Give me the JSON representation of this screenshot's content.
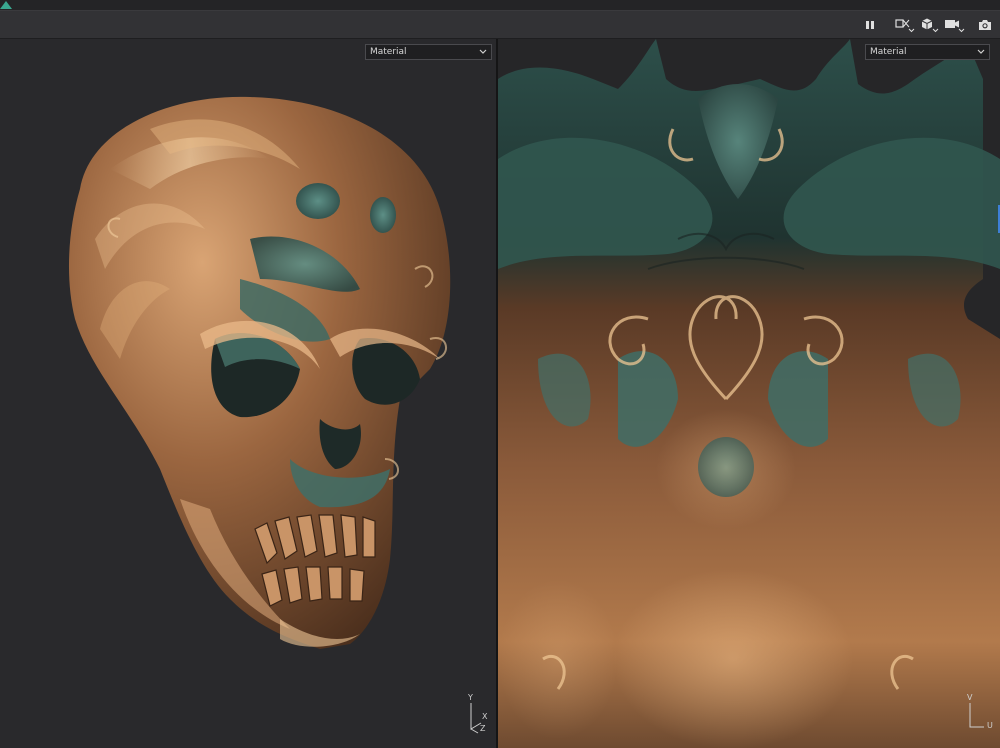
{
  "toolbar": {
    "buttons": [
      {
        "name": "pause-button",
        "icon": "pause-icon"
      },
      {
        "name": "shading-mode-button",
        "icon": "shading-mode-icon"
      },
      {
        "name": "view-cube-button",
        "icon": "cube-icon"
      },
      {
        "name": "camera-button",
        "icon": "video-camera-icon"
      },
      {
        "name": "screenshot-button",
        "icon": "camera-snapshot-icon"
      }
    ]
  },
  "viewport3d": {
    "channel_select": "Material",
    "axis_labels": {
      "y": "Y",
      "x": "X",
      "z": "Z"
    },
    "colors": {
      "background": "#29292c",
      "bronze": "#a66f45",
      "patina": "#3d6b63"
    }
  },
  "viewport2d": {
    "channel_select": "Material",
    "axis_labels": {
      "v": "V",
      "u": "U"
    }
  }
}
